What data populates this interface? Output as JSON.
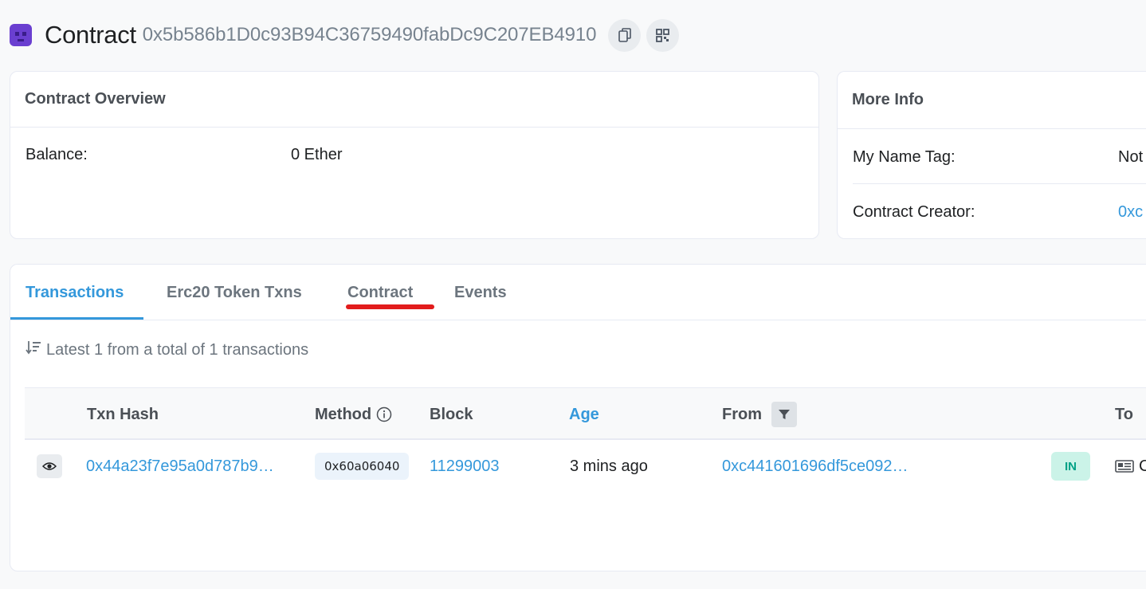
{
  "header": {
    "title": "Contract",
    "address": "0x5b586b1D0c93B94C36759490fabDc9C207EB4910",
    "copy_icon": "copy-icon",
    "qr_icon": "qr-code-icon"
  },
  "overview": {
    "heading": "Contract Overview",
    "balance_label": "Balance:",
    "balance_value": "0 Ether"
  },
  "more_info": {
    "heading": "More Info",
    "name_tag_label": "My Name Tag:",
    "name_tag_value": "Not",
    "creator_label": "Contract Creator:",
    "creator_value": "0xc"
  },
  "tabs": [
    {
      "label": "Transactions",
      "active": true
    },
    {
      "label": "Erc20 Token Txns",
      "active": false
    },
    {
      "label": "Contract",
      "active": false
    },
    {
      "label": "Events",
      "active": false
    }
  ],
  "summary": {
    "text": "Latest 1 from a total of 1 transactions"
  },
  "table": {
    "headers": {
      "txn_hash": "Txn Hash",
      "method": "Method",
      "block": "Block",
      "age": "Age",
      "from": "From",
      "to": "To"
    },
    "rows": [
      {
        "txn_hash": "0x44a23f7e95a0d787b9…",
        "method": "0x60a06040",
        "block": "11299003",
        "age": "3 mins ago",
        "from": "0xc441601696df5ce092…",
        "direction": "IN",
        "to": "C"
      }
    ]
  },
  "colors": {
    "link": "#3498db",
    "annotation_red": "#e21c1c",
    "in_badge_bg": "#cbf3e8",
    "in_badge_text": "#00a186"
  }
}
